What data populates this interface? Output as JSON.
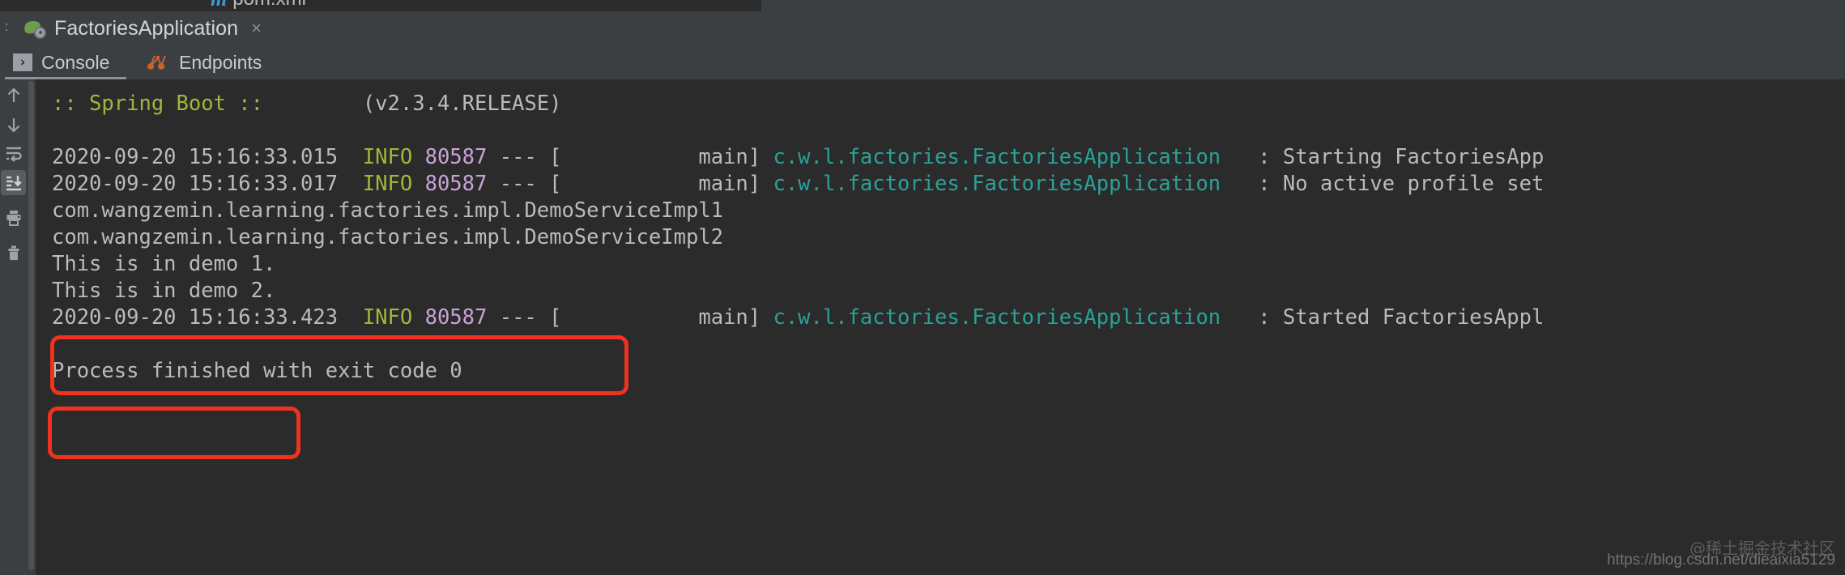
{
  "editor": {
    "tab_label": "pom.xml",
    "tab_icon": "maven-m-icon"
  },
  "run_tool_window": {
    "gutter_dots": ":",
    "tab_label": "FactoriesApplication",
    "tab_icon": "spring-boot-leaf-icon",
    "close_label": "×",
    "subtabs": [
      {
        "label": "Console",
        "icon": "console-prompt-icon",
        "selected": true
      },
      {
        "label": "Endpoints",
        "icon": "endpoints-graph-icon",
        "selected": false
      }
    ]
  },
  "toolbar": {
    "buttons": [
      {
        "name": "scroll-up-button",
        "icon": "arrow-up-icon",
        "active": false
      },
      {
        "name": "scroll-down-button",
        "icon": "arrow-down-icon",
        "active": false
      },
      {
        "name": "soft-wrap-button",
        "icon": "soft-wrap-icon",
        "active": false
      },
      {
        "name": "scroll-to-end-button",
        "icon": "scroll-to-end-icon",
        "active": true
      },
      {
        "name": "print-button",
        "icon": "printer-icon",
        "active": false
      },
      {
        "name": "clear-all-button",
        "icon": "trash-icon",
        "active": false
      }
    ]
  },
  "console": {
    "lines": [
      {
        "id": "banner",
        "segments": [
          {
            "text": ":: Spring Boot ::",
            "color": "green"
          },
          {
            "text": "        (v2.3.4.RELEASE)",
            "color": "gray"
          }
        ]
      },
      {
        "id": "log-starting",
        "segments": [
          {
            "text": "2020-09-20 15:16:33.015  ",
            "color": "gray"
          },
          {
            "text": "INFO",
            "color": "green"
          },
          {
            "text": " ",
            "color": "gray"
          },
          {
            "text": "80587",
            "color": "purple"
          },
          {
            "text": " --- [           main] ",
            "color": "gray"
          },
          {
            "text": "c.w.l.factories.FactoriesApplication",
            "color": "teal"
          },
          {
            "text": "   : Starting FactoriesApp",
            "color": "gray"
          }
        ]
      },
      {
        "id": "log-no-profile",
        "segments": [
          {
            "text": "2020-09-20 15:16:33.017  ",
            "color": "gray"
          },
          {
            "text": "INFO",
            "color": "green"
          },
          {
            "text": " ",
            "color": "gray"
          },
          {
            "text": "80587",
            "color": "purple"
          },
          {
            "text": " --- [           main] ",
            "color": "gray"
          },
          {
            "text": "c.w.l.factories.FactoriesApplication",
            "color": "teal"
          },
          {
            "text": "   : No active profile set",
            "color": "gray"
          }
        ]
      },
      {
        "id": "impl1",
        "segments": [
          {
            "text": "com.wangzemin.learning.factories.impl.DemoServiceImpl1",
            "color": "gray"
          }
        ]
      },
      {
        "id": "impl2",
        "segments": [
          {
            "text": "com.wangzemin.learning.factories.impl.DemoServiceImpl2",
            "color": "gray"
          }
        ]
      },
      {
        "id": "demo1",
        "segments": [
          {
            "text": "This is in demo 1.",
            "color": "gray"
          }
        ]
      },
      {
        "id": "demo2",
        "segments": [
          {
            "text": "This is in demo 2.",
            "color": "gray"
          }
        ]
      },
      {
        "id": "log-started",
        "segments": [
          {
            "text": "2020-09-20 15:16:33.423  ",
            "color": "gray"
          },
          {
            "text": "INFO",
            "color": "green"
          },
          {
            "text": " ",
            "color": "gray"
          },
          {
            "text": "80587",
            "color": "purple"
          },
          {
            "text": " --- [           main] ",
            "color": "gray"
          },
          {
            "text": "c.w.l.factories.FactoriesApplication",
            "color": "teal"
          },
          {
            "text": "   : Started FactoriesAppl",
            "color": "gray"
          }
        ]
      },
      {
        "id": "process-finished",
        "segments": [
          {
            "text": "Process finished with exit code 0",
            "color": "gray"
          }
        ]
      }
    ]
  },
  "annotations": {
    "box_color": "#f0321e",
    "boxes": [
      {
        "name": "impl-class-names-highlight"
      },
      {
        "name": "demo-output-highlight"
      }
    ]
  },
  "watermark": {
    "account": "@稀土掘金技术社区",
    "url": "https://blog.csdn.net/dieaixia5129"
  }
}
